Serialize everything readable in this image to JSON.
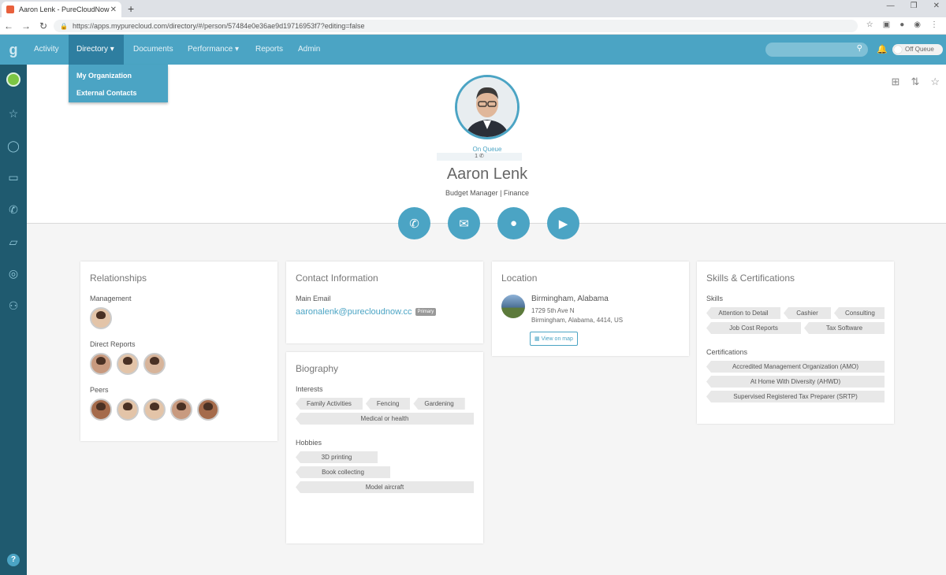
{
  "browser": {
    "tab_title": "Aaron Lenk - PureCloudNow",
    "url": "https://apps.mypurecloud.com/directory/#/person/57484e0e36ae9d19716953f7?editing=false"
  },
  "nav": {
    "items": [
      "Activity",
      "Directory",
      "Documents",
      "Performance",
      "Reports",
      "Admin"
    ],
    "queue_status": "Off Queue"
  },
  "directory_menu": {
    "items": [
      "My Organization",
      "External Contacts"
    ]
  },
  "profile": {
    "status": "On Queue",
    "presence_count": "1",
    "name": "Aaron Lenk",
    "title": "Budget Manager | Finance"
  },
  "relationships": {
    "heading": "Relationships",
    "management_label": "Management",
    "direct_reports_label": "Direct Reports",
    "peers_label": "Peers"
  },
  "contact": {
    "heading": "Contact Information",
    "email_label": "Main Email",
    "email": "aaronalenk@purecloudnow.cc",
    "email_badge": "Primary"
  },
  "biography": {
    "heading": "Biography",
    "interests_label": "Interests",
    "interests": [
      "Family Activities",
      "Fencing",
      "Gardening",
      "Medical or health"
    ],
    "hobbies_label": "Hobbies",
    "hobbies": [
      "3D printing",
      "Book collecting",
      "Model aircraft"
    ]
  },
  "location": {
    "heading": "Location",
    "city": "Birmingham, Alabama",
    "street": "1729 5th Ave N",
    "region": "Birmingham, Alabama, 4414, US",
    "map_button": "View on map"
  },
  "skills": {
    "heading": "Skills & Certifications",
    "skills_label": "Skills",
    "skills": [
      "Attention to Detail",
      "Cashier",
      "Consulting",
      "Job Cost Reports",
      "Tax Software"
    ],
    "certifications_label": "Certifications",
    "certifications": [
      "Accredited Management Organization (AMO)",
      "At Home With Diversity (AHWD)",
      "Supervised Registered Tax Preparer (SRTP)"
    ]
  }
}
